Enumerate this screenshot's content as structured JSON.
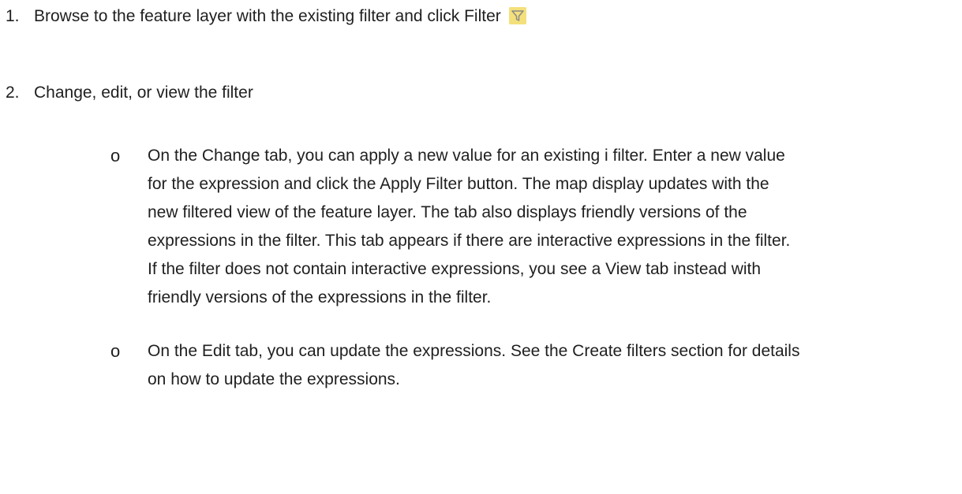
{
  "steps": [
    {
      "number": "1.",
      "text": "Browse to the feature layer with the existing filter and click Filter",
      "icon": "filter-icon"
    },
    {
      "number": "2.",
      "text": "Change, edit, or view the filter"
    }
  ],
  "bullets": [
    {
      "marker": "o",
      "lines": [
        "On the Change tab, you can apply a new value for an existing i filter. Enter a new value",
        "for the expression and click the Apply Filter button. The map display updates with the",
        "new filtered view of the feature layer. The tab also displays friendly versions of the",
        "expressions in the filter. This tab appears if there are interactive expressions in the filter.",
        "If the filter does not contain interactive expressions, you see a View tab instead with",
        "friendly versions of the expressions in the filter."
      ]
    },
    {
      "marker": "o",
      "lines": [
        "On the Edit tab, you can update the expressions. See the Create filters section for details",
        "on how to update the expressions."
      ]
    }
  ],
  "colors": {
    "text": "#1f1f1f",
    "icon_background": "#f4e07a",
    "icon_funnel": "#8a8a8a"
  }
}
